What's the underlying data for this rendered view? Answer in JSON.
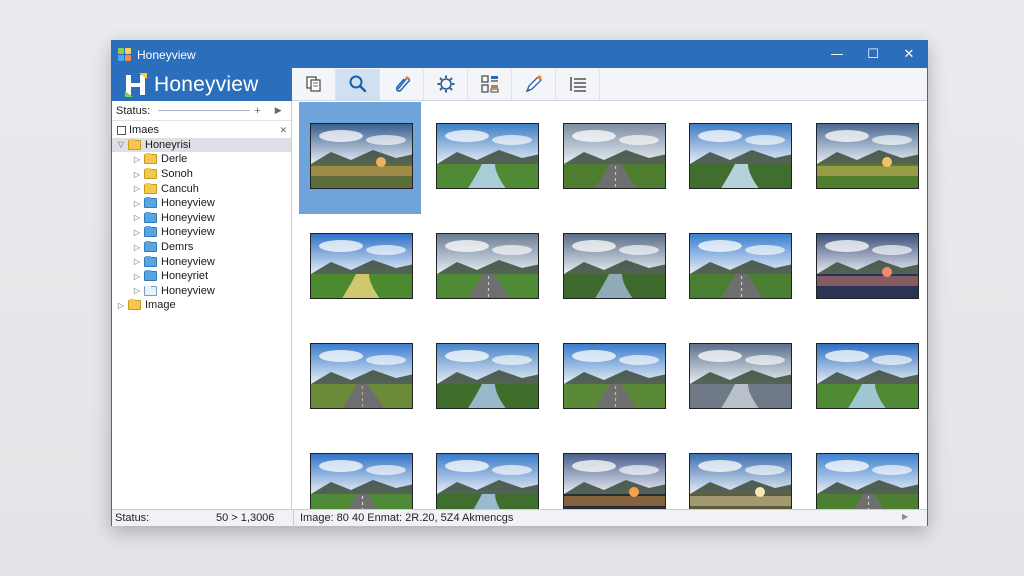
{
  "window": {
    "title": "Honeyview",
    "controls": {
      "minimize": "—",
      "maximize": "☐",
      "close": "✕"
    }
  },
  "brand": {
    "name": "Honeyview"
  },
  "toolbar": {
    "tools": [
      {
        "name": "copy-icon",
        "active": false
      },
      {
        "name": "search-icon",
        "active": true
      },
      {
        "name": "attach-icon",
        "active": false
      },
      {
        "name": "settings-icon",
        "active": false
      },
      {
        "name": "grid-view-icon",
        "active": false
      },
      {
        "name": "edit-icon",
        "active": false
      },
      {
        "name": "list-view-icon",
        "active": false
      }
    ]
  },
  "sidebar": {
    "status_label": "Status:",
    "status_plus": "+",
    "status_arrow": "▶",
    "tree": {
      "root": {
        "label": "Imaes",
        "close": "✕"
      },
      "items": [
        {
          "label": "Honeyrisi",
          "folder": "yellow",
          "expander": "▽",
          "selected": true
        },
        {
          "label": "Derle",
          "folder": "yellow",
          "expander": "▷"
        },
        {
          "label": "Sonoh",
          "folder": "yellow",
          "expander": "▷"
        },
        {
          "label": "Cancuh",
          "folder": "yellow",
          "expander": "▷"
        },
        {
          "label": "Honeyview",
          "folder": "blue",
          "expander": "▷"
        },
        {
          "label": "Honeyview",
          "folder": "blue",
          "expander": "▷"
        },
        {
          "label": "Honeyview",
          "folder": "blue",
          "expander": "▷"
        },
        {
          "label": "Demrs",
          "folder": "blue",
          "expander": "▷"
        },
        {
          "label": "Honeyview",
          "folder": "blue",
          "expander": "▷"
        },
        {
          "label": "Honeyriet",
          "folder": "blue",
          "expander": "▷"
        },
        {
          "label": "Honeyview",
          "folder": "doc",
          "expander": "▷"
        }
      ],
      "last": {
        "label": "Image",
        "expander": "▷"
      }
    }
  },
  "thumbnails": {
    "selected_index": 0,
    "items": [
      {
        "sky": "#3a5f8f",
        "ground": "#5b6d3a",
        "accent": "#f0b060",
        "style": "sunset-lake"
      },
      {
        "sky": "#3d7fc6",
        "ground": "#4f8a34",
        "accent": "#b9d8f5",
        "style": "river"
      },
      {
        "sky": "#7e8ea3",
        "ground": "#4e7d30",
        "accent": "#d9c97c",
        "style": "road"
      },
      {
        "sky": "#3f7cc4",
        "ground": "#3f6e2e",
        "accent": "#cde3f8",
        "style": "river"
      },
      {
        "sky": "#4a6a93",
        "ground": "#4d7f2d",
        "accent": "#f5c06a",
        "style": "sunset-lake"
      },
      {
        "sky": "#2f73c8",
        "ground": "#4c8a30",
        "accent": "#e8d27a",
        "style": "river"
      },
      {
        "sky": "#6c7f96",
        "ground": "#4f8a36",
        "accent": "#c9c9c9",
        "style": "road"
      },
      {
        "sky": "#5b6f87",
        "ground": "#3d6a2c",
        "accent": "#9fb6cf",
        "style": "river"
      },
      {
        "sky": "#3a7fcf",
        "ground": "#4a7f33",
        "accent": "#cfcfcf",
        "style": "road"
      },
      {
        "sky": "#3d4f7a",
        "ground": "#2a3556",
        "accent": "#f28a72",
        "style": "sunset-lake"
      },
      {
        "sky": "#3c7ed0",
        "ground": "#6b8a3a",
        "accent": "#b7a98c",
        "style": "road"
      },
      {
        "sky": "#4a86c8",
        "ground": "#3e6d2c",
        "accent": "#a9c7e8",
        "style": "river"
      },
      {
        "sky": "#3b7dcc",
        "ground": "#5a8a38",
        "accent": "#c9b98b",
        "style": "road"
      },
      {
        "sky": "#5c718c",
        "ground": "#707a86",
        "accent": "#c4ccd6",
        "style": "river"
      },
      {
        "sky": "#2f70c2",
        "ground": "#4e8a34",
        "accent": "#b0d0f0",
        "style": "river"
      },
      {
        "sky": "#3275c6",
        "ground": "#4f8a36",
        "accent": "#d8d8d8",
        "style": "road"
      },
      {
        "sky": "#3c7cc9",
        "ground": "#3e6f2f",
        "accent": "#a8c9ea",
        "style": "river"
      },
      {
        "sky": "#4b5f8c",
        "ground": "#2c2c36",
        "accent": "#f2a34a",
        "style": "sunset-lake"
      },
      {
        "sky": "#3d6fae",
        "ground": "#5e5a3a",
        "accent": "#f6e8b0",
        "style": "sunset-lake"
      },
      {
        "sky": "#3f82d0",
        "ground": "#4c7f30",
        "accent": "#d0d0d0",
        "style": "road"
      }
    ]
  },
  "statusbar": {
    "left_label": "Status:",
    "left_value": "50 > 1,3006",
    "info": "Image: 80 40 Enmat: 2R.20, 5Z4 Akmencgs",
    "arrow": "▶"
  }
}
